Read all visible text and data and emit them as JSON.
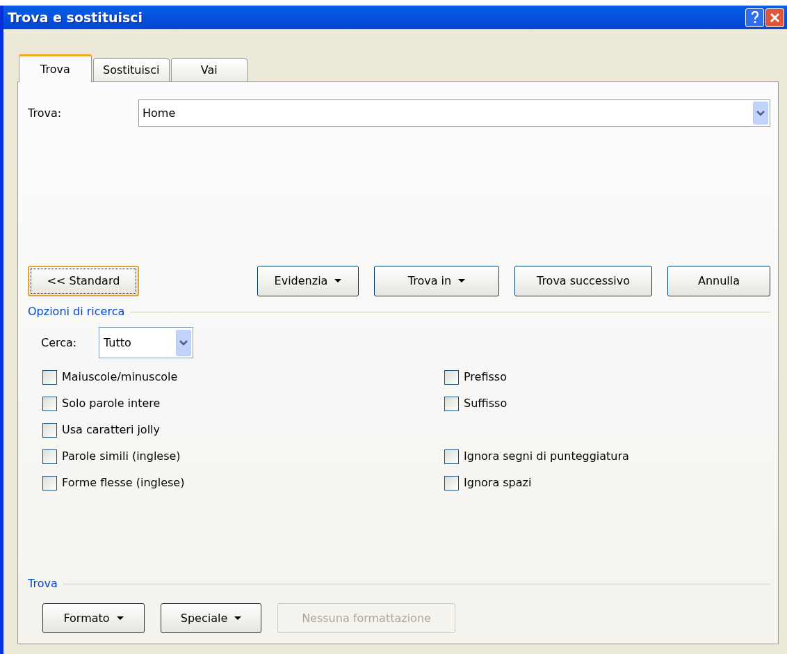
{
  "window": {
    "title": "Trova e sostituisci"
  },
  "tabs": [
    {
      "label": "Trova",
      "selected": true
    },
    {
      "label": "Sostituisci",
      "selected": false
    },
    {
      "label": "Vai",
      "selected": false
    }
  ],
  "find_field": {
    "label": "Trova:",
    "value": "Home"
  },
  "buttons": [
    {
      "label": "<< Standard",
      "dropdown": false,
      "focused": true
    },
    {
      "label": "Evidenzia",
      "dropdown": true,
      "focused": false
    },
    {
      "label": "Trova in",
      "dropdown": true,
      "focused": false
    },
    {
      "label": "Trova successivo",
      "dropdown": false,
      "focused": false
    },
    {
      "label": "Annulla",
      "dropdown": false,
      "focused": false
    }
  ],
  "search_options": {
    "title": "Opzioni di ricerca",
    "search_in": {
      "label": "Cerca:",
      "value": "Tutto"
    },
    "rows": [
      {
        "left": {
          "label": "Maiuscole/minuscole",
          "checked": false
        },
        "right": {
          "label": "Prefisso",
          "checked": false
        }
      },
      {
        "left": {
          "label": "Solo parole intere",
          "checked": false
        },
        "right": {
          "label": "Suffisso",
          "checked": false
        }
      },
      {
        "left": {
          "label": "Usa caratteri jolly",
          "checked": false
        }
      },
      {
        "left": {
          "label": "Parole simili (inglese)",
          "checked": false
        },
        "right": {
          "label": "Ignora segni di punteggiatura",
          "checked": false
        }
      },
      {
        "left": {
          "label": "Forme flesse (inglese)",
          "checked": false
        },
        "right": {
          "label": "Ignora spazi",
          "checked": false
        }
      }
    ]
  },
  "find_section": {
    "title": "Trova",
    "buttons": [
      {
        "label": "Formato",
        "dropdown": true,
        "disabled": false
      },
      {
        "label": "Speciale",
        "dropdown": true,
        "disabled": false
      },
      {
        "label": "Nessuna formattazione",
        "dropdown": false,
        "disabled": true
      }
    ]
  }
}
